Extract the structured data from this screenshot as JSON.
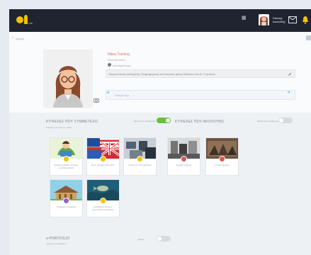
{
  "topbar": {
    "logo_text": "e-me",
    "user_name": [
      "Γιαννης",
      "Ιωαννιδης"
    ]
  },
  "nav": {
    "back_label": "Αρχική"
  },
  "profile": {
    "name": "Νίκος Γιαλίνης",
    "title": "Εκπαιδευτικός",
    "count": "Αποθηκεύτηκε",
    "bio": "Οικογενειακός καθηγητής Πληροφορικής και Ιστορίας φίλης διδάσκω στο Α΄ Γυμνάσιο",
    "quote": "Όνομα-λογί"
  },
  "sections": {
    "participate": {
      "title": "ΚΥΨΕΛΕΣ ΠΟΥ ΣΥΜΜΕΤΕΧΩ",
      "subtitle": "Κυψέλες από όλη την λίστα",
      "toggle_label": "Ορατό στο προφίλ μου"
    },
    "follow": {
      "title": "ΚΥΨΕΛΕΣ ΠΟΥ ΑΚΟΛΟΥΘΩ",
      "toggle_label": "Ορατό στο προφίλ μου"
    },
    "portfolio": {
      "title": "e-PORTFOLIO",
      "subtitle": "Αρχεία και συνδέσμοι",
      "toggle_label": "Ορατό"
    }
  },
  "cards": [
    {
      "label": "Σχολική εργασία: Ιστορίες με ιδιαιτερότητα",
      "badge": "yellow",
      "image": "reading-child"
    },
    {
      "label": "Be 1, Αγγλικά τάξη (Α΄1)",
      "badge": "yellow",
      "image": "flags"
    },
    {
      "label": "Ιστορία Α΄ Γ3 Γυμνασίου",
      "badge": "yellow",
      "image": "classroom"
    },
    {
      "label": "Ομάδα Ιστορίας",
      "badge": "red",
      "image": "historic-bw"
    },
    {
      "label": "Ιστορία Αρχαίοι",
      "badge": "red",
      "image": "war-scene"
    },
    {
      "label": "Ολοήμερο Ιστορικής",
      "badge": "purple",
      "image": "temple-drawing"
    },
    {
      "label": "Θαλάσσιος κόσμος, προστασία και δράσεις",
      "badge": "yellow",
      "image": "underwater"
    }
  ],
  "colors": {
    "accent": "#d86b5b",
    "toggle_on": "#67c23a",
    "quote_blue": "#2b88d8"
  },
  "icons": {
    "menu": "hamburger-icon",
    "message": "envelope-icon",
    "notification": "bell-icon",
    "back": "chevron-left-icon",
    "camera": "camera-icon",
    "edit": "pencil-icon",
    "quote": "quote-icon"
  }
}
